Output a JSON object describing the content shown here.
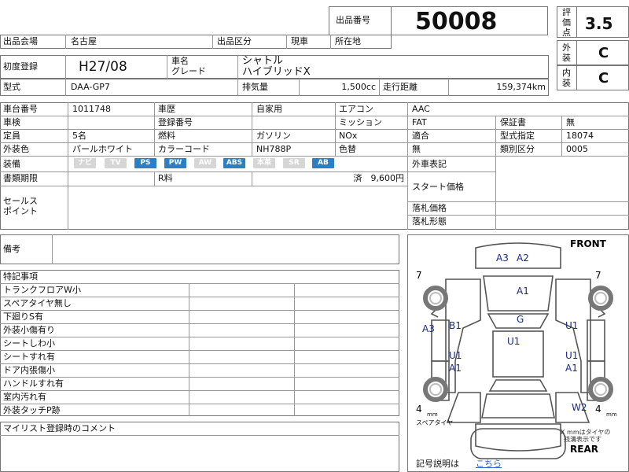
{
  "lot": {
    "label": "出品番号",
    "number": "50008"
  },
  "rating": {
    "label_chars": [
      "評",
      "価",
      "点"
    ],
    "score": "3.5"
  },
  "exterior": {
    "label_chars": [
      "外",
      "装"
    ],
    "grade": "C"
  },
  "interior": {
    "label_chars": [
      "内",
      "装"
    ],
    "grade": "C"
  },
  "venue": {
    "label": "出品会場",
    "value": "名古屋",
    "class_label": "出品区分",
    "class_value": "現車",
    "location_label": "所在地"
  },
  "first_reg": {
    "label": "初度登録",
    "value": "H27/08"
  },
  "car_name": {
    "label1": "車名",
    "label2": "グレード",
    "name": "シャトル",
    "grade": "ハイブリッドX"
  },
  "model": {
    "label": "型式",
    "value": "DAA-GP7"
  },
  "displacement": {
    "label": "排気量",
    "value": "1,500cc"
  },
  "mileage": {
    "label": "走行距離",
    "value": "159,374km"
  },
  "specs": {
    "chassis_no_label": "車台番号",
    "chassis_no": "1011748",
    "history_label": "車歴",
    "history": "自家用",
    "aircon_label": "エアコン",
    "aircon": "AAC",
    "inspection_label": "車検",
    "reg_no_label": "登録番号",
    "mission_label": "ミッション",
    "mission": "FAT",
    "warranty_label": "保証書",
    "warranty": "無",
    "capacity_label": "定員",
    "capacity": "5名",
    "fuel_label": "燃料",
    "fuel": "ガソリン",
    "nox_label": "NOx",
    "compliance_label": "適合",
    "model_designation_label": "型式指定",
    "model_designation": "18074",
    "color_label": "外装色",
    "color": "パールホワイト",
    "color_code_label": "カラーコード",
    "color_code": "NH788P",
    "repaint_label": "色替",
    "repaint": "無",
    "category_label": "類別区分",
    "category": "0005"
  },
  "equipment": {
    "label": "装備",
    "items": [
      {
        "name": "ナビ",
        "on": false
      },
      {
        "name": "TV",
        "on": false
      },
      {
        "name": "PS",
        "on": true
      },
      {
        "name": "PW",
        "on": true
      },
      {
        "name": "AW",
        "on": false
      },
      {
        "name": "ABS",
        "on": true
      },
      {
        "name": "本革",
        "on": false
      },
      {
        "name": "SR",
        "on": false
      },
      {
        "name": "AB",
        "on": true
      }
    ]
  },
  "docs": {
    "label": "書類期限",
    "r_fee_label": "R料",
    "r_fee": "済　9,600円"
  },
  "price": {
    "foreign_label": "外車表記",
    "start_label": "スタート価格",
    "hammer_label": "落札価格",
    "form_label": "落札形態"
  },
  "sales_point": {
    "label_line1": "セールス",
    "label_line2": "ポイント"
  },
  "remarks": {
    "label": "備考"
  },
  "notes": {
    "label": "特記事項",
    "items": [
      "トランクフロアW小",
      "スペアタイヤ無し",
      "下廻りS有",
      "外装小傷有り",
      "シートしわ小",
      "シートすれ有",
      "ドア内張傷小",
      "ハンドルすれ有",
      "室内汚れ有",
      "外装タッチP跡"
    ]
  },
  "mylist": {
    "label": "マイリスト登録時のコメント"
  },
  "diagram": {
    "front": "FRONT",
    "rear": "REAR",
    "marks": {
      "a3_front": "A3",
      "a2_front": "A2",
      "a1_hood": "A1",
      "g_glass": "G",
      "a3_left": "A3",
      "b1_left": "B1",
      "u1_left_door": "U1",
      "a1_left_door": "A1",
      "u1_roof": "U1",
      "u1_right_front": "U1",
      "u1_right_door": "U1",
      "a1_right_door": "A1",
      "w2_rear": "W2"
    },
    "tire_fl": "7",
    "tire_fr": "7",
    "tire_rl": "4",
    "tire_rr": "4",
    "spare": "スペアタイヤ",
    "mm_small": "mm",
    "tire_note_line1": "X mmはタイヤの",
    "tire_note_line2": "残溝表示です"
  },
  "legend": {
    "label": "記号説明は",
    "link": "こちら"
  },
  "colors": {
    "equip_on": "#2d7fc5",
    "equip_off": "#d6d6d6",
    "diagram_label": "#1a2a8a",
    "link": "#2266cc"
  }
}
